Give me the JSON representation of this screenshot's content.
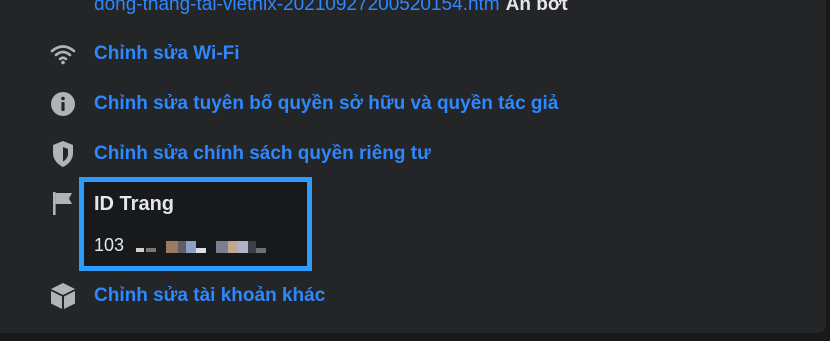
{
  "top": {
    "url_text": "dong-thang-tai-vietnix-20210927200520154.htm",
    "hide_label": "Ẩn bớt"
  },
  "items": [
    {
      "label": "Chỉnh sửa Wi-Fi",
      "icon": "wifi-icon"
    },
    {
      "label": "Chỉnh sửa tuyên bố quyền sở hữu và quyền tác giả",
      "icon": "info-icon"
    },
    {
      "label": "Chỉnh sửa chính sách quyền riêng tư",
      "icon": "shield-icon"
    },
    {
      "label": "Chỉnh sửa tài khoản khác",
      "icon": "cube-icon"
    }
  ],
  "page_id": {
    "title": "ID Trang",
    "value": "103",
    "icon": "flag-icon"
  },
  "colors": {
    "background": "#242526",
    "link": "#2d88ff",
    "text": "#e4e6eb",
    "highlight": "#2d9cff",
    "icon": "#b0b3b8"
  }
}
